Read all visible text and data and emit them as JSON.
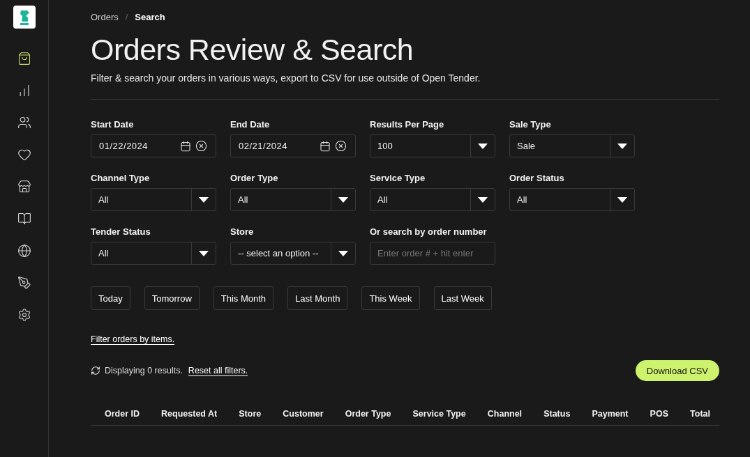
{
  "sidebar": {
    "items": [
      {
        "kind": "bag",
        "selected": true
      },
      {
        "kind": "chart",
        "selected": false
      },
      {
        "kind": "people",
        "selected": false
      },
      {
        "kind": "heart",
        "selected": false
      },
      {
        "kind": "store",
        "selected": false
      },
      {
        "kind": "book",
        "selected": false
      },
      {
        "kind": "globe",
        "selected": false
      },
      {
        "kind": "pen",
        "selected": false
      },
      {
        "kind": "gear",
        "selected": false
      }
    ]
  },
  "breadcrumb": {
    "items": [
      "Orders",
      "Search"
    ],
    "separator": "/"
  },
  "title": "Orders Review & Search",
  "subtitle": "Filter & search your orders in various ways, export to CSV for use outside of Open Tender.",
  "filters": [
    {
      "kind": "date",
      "label": "Start Date",
      "value": "01/22/2024"
    },
    {
      "kind": "date",
      "label": "End Date",
      "value": "02/21/2024"
    },
    {
      "kind": "select",
      "label": "Results Per Page",
      "value": "100"
    },
    {
      "kind": "select",
      "label": "Sale Type",
      "value": "Sale"
    },
    {
      "kind": "select",
      "label": "Channel Type",
      "value": "All"
    },
    {
      "kind": "select",
      "label": "Order Type",
      "value": "All"
    },
    {
      "kind": "select",
      "label": "Service Type",
      "value": "All"
    },
    {
      "kind": "select",
      "label": "Order Status",
      "value": "All"
    },
    {
      "kind": "select",
      "label": "Tender Status",
      "value": "All"
    },
    {
      "kind": "select",
      "label": "Store",
      "value": "-- select an option --"
    },
    {
      "kind": "text",
      "label": "Or search by order number",
      "placeholder": "Enter order # + hit enter"
    }
  ],
  "quick_ranges": [
    "Today",
    "Tomorrow",
    "This Month",
    "Last Month",
    "This Week",
    "Last Week"
  ],
  "item_filter_link": "Filter orders by items.",
  "results_text": "Displaying 0 results.",
  "reset_link": "Reset all filters.",
  "download_button": "Download CSV",
  "table": {
    "columns": [
      "Order ID",
      "Requested At",
      "Store",
      "Customer",
      "Order Type",
      "Service Type",
      "Channel",
      "Status",
      "Payment",
      "POS",
      "Total"
    ]
  }
}
